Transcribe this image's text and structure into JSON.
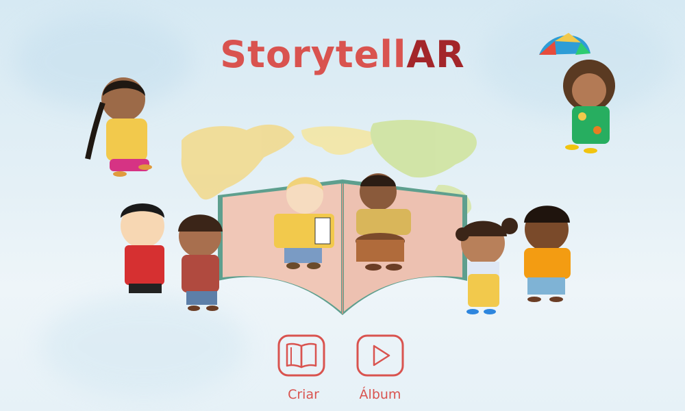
{
  "app": {
    "title_part1": "Storytell",
    "title_part2": "AR"
  },
  "menu": {
    "create_label": "Criar",
    "album_label": "Álbum"
  },
  "colors": {
    "accent": "#d9534f",
    "accent_dark": "#a3262a",
    "sky": "#d6e9f3"
  },
  "icons": {
    "create": "open-book-icon",
    "album": "play-icon"
  }
}
